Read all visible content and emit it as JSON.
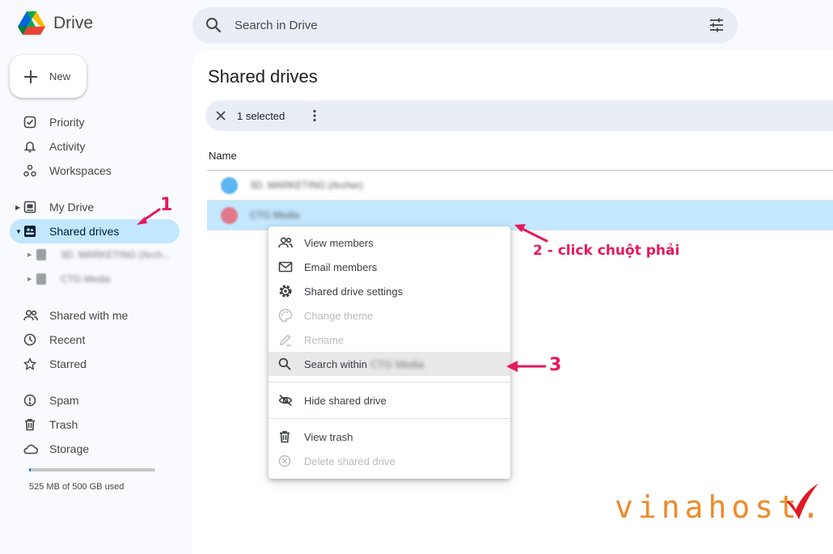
{
  "app": {
    "name": "Drive"
  },
  "search": {
    "placeholder": "Search in Drive"
  },
  "new_button": {
    "label": "New"
  },
  "sidebar": {
    "items": [
      {
        "label": "Priority",
        "icon": "priority-icon"
      },
      {
        "label": "Activity",
        "icon": "bell-icon"
      },
      {
        "label": "Workspaces",
        "icon": "workspaces-icon"
      },
      {
        "label": "My Drive",
        "icon": "my-drive-icon"
      },
      {
        "label": "Shared drives",
        "icon": "shared-drives-icon"
      },
      {
        "label": "Shared with me",
        "icon": "people-icon"
      },
      {
        "label": "Recent",
        "icon": "clock-icon"
      },
      {
        "label": "Starred",
        "icon": "star-icon"
      },
      {
        "label": "Spam",
        "icon": "spam-icon"
      },
      {
        "label": "Trash",
        "icon": "trash-icon"
      },
      {
        "label": "Storage",
        "icon": "cloud-icon"
      }
    ],
    "sub_drives": [
      {
        "label": "3D. MARKETING (Arch..."
      },
      {
        "label": "CTG Media"
      }
    ],
    "storage_text": "525 MB of 500 GB used",
    "storage_fraction": 0.01
  },
  "main": {
    "title": "Shared drives",
    "selection": {
      "text": "1 selected"
    },
    "column_header": "Name",
    "rows": [
      {
        "name": "3D. MARKETING (Archer)",
        "color": "#5bb5f0",
        "selected": false
      },
      {
        "name": "CTG Media",
        "color": "#e07a8a",
        "selected": true
      }
    ]
  },
  "context_menu": {
    "items": [
      {
        "label": "View members",
        "icon": "people-icon",
        "disabled": false
      },
      {
        "label": "Email members",
        "icon": "mail-icon",
        "disabled": false
      },
      {
        "label": "Shared drive settings",
        "icon": "settings-icon",
        "disabled": false
      },
      {
        "label": "Change theme",
        "icon": "palette-icon",
        "disabled": true
      },
      {
        "label": "Rename",
        "icon": "pencil-icon",
        "disabled": true
      },
      {
        "label": "Search within",
        "label_suffix": "CTG Media",
        "icon": "search-icon",
        "disabled": false
      },
      {
        "label": "Hide shared drive",
        "icon": "eye-off-icon",
        "disabled": false
      },
      {
        "label": "View trash",
        "icon": "trash-icon",
        "disabled": false
      },
      {
        "label": "Delete shared drive",
        "icon": "delete-circle-icon",
        "disabled": true
      }
    ]
  },
  "annotations": {
    "step1": "1",
    "step2": "2 - click chuột phải",
    "step3": "3"
  },
  "watermark": {
    "text": "vinahost."
  },
  "colors": {
    "accent_pink": "#e8175d",
    "selected_bg": "#c2e7ff",
    "watermark_orange": "#ef8a2a",
    "watermark_red": "#e01b24"
  }
}
